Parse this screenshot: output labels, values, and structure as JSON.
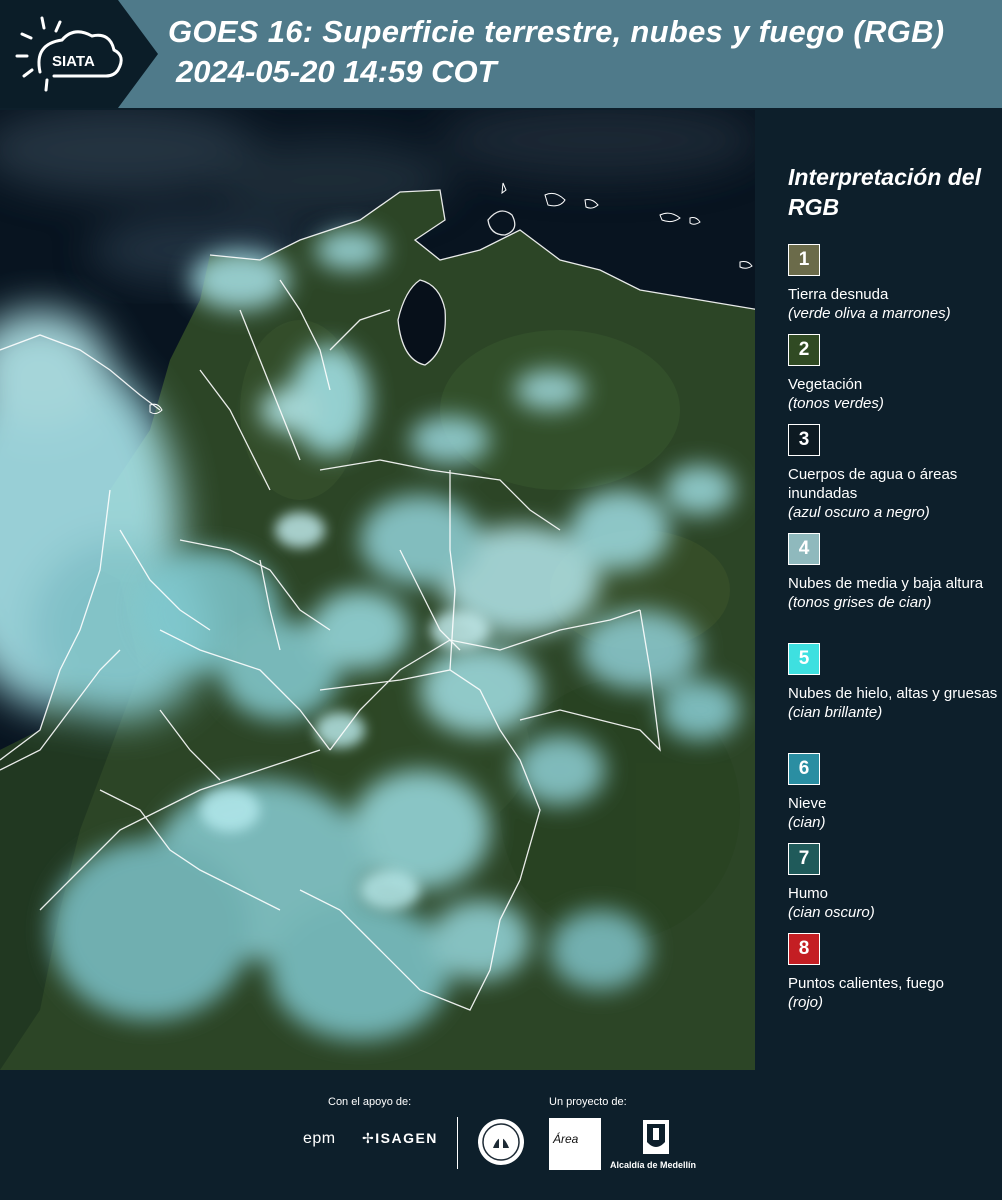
{
  "header": {
    "logo_text": "SIATA",
    "title": "GOES 16: Superficie terrestre, nubes y fuego (RGB)",
    "datetime": "2024-05-20 14:59 COT"
  },
  "map": {
    "image_description": "satellite-rgb-image-colombia",
    "colors": {
      "ocean": "#07121b",
      "vegetation": "#2e4a2a",
      "cloud": "#8fe3ea",
      "border": "#ffffff"
    }
  },
  "legend": {
    "title": "Interpretación del RGB",
    "items": [
      {
        "number": "1",
        "label": "Tierra desnuda",
        "sub": "(verde oliva a marrones)",
        "color": "#6b6b4a"
      },
      {
        "number": "2",
        "label": "Vegetación",
        "sub": "(tonos verdes)",
        "color": "#304a23"
      },
      {
        "number": "3",
        "label": "Cuerpos de agua o áreas inundadas",
        "sub": "(azul oscuro a negro)",
        "color": "#0d1a22"
      },
      {
        "number": "4",
        "label": "Nubes de media y baja altura",
        "sub": "(tonos grises de cian)",
        "color": "#8fb9bd"
      },
      {
        "number": "5",
        "label": "Nubes de hielo, altas y gruesas",
        "sub": "(cian brillante)",
        "color": "#3ee0e0"
      },
      {
        "number": "6",
        "label": "Nieve",
        "sub": "(cian)",
        "color": "#2a8ea2"
      },
      {
        "number": "7",
        "label": "Humo",
        "sub": "(cian oscuro)",
        "color": "#1f5a5a"
      },
      {
        "number": "8",
        "label": "Puntos calientes, fuego",
        "sub": "(rojo)",
        "color": "#c41e23"
      }
    ]
  },
  "footer": {
    "support_label": "Con el apoyo de:",
    "project_label": "Un proyecto de:",
    "sponsors": [
      "epm",
      "ISAGEN"
    ],
    "partners": [
      "Área",
      "Alcaldía de Medellín"
    ]
  }
}
